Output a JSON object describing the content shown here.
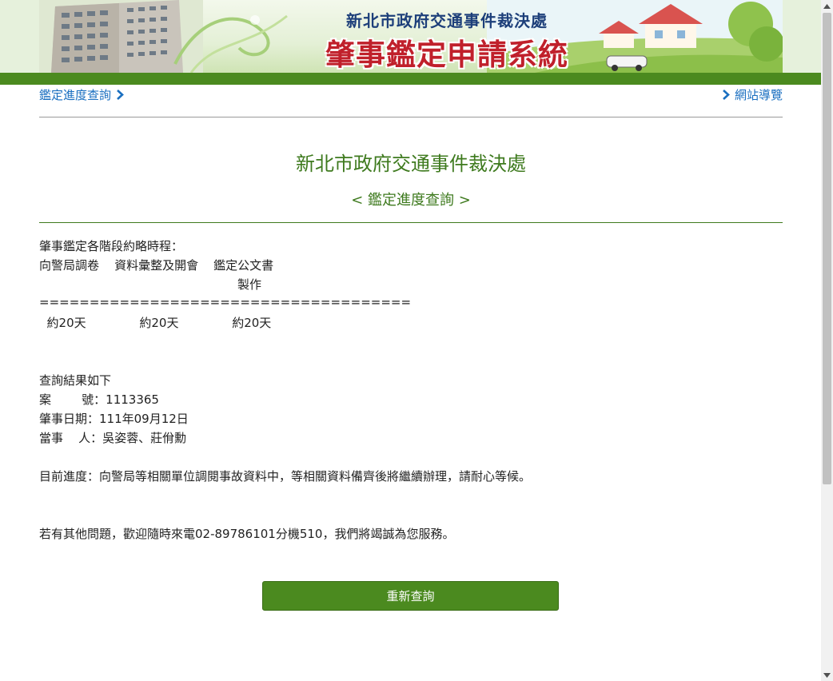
{
  "banner": {
    "subtitle": "新北市政府交通事件裁決處",
    "title": "肇事鑑定申請系統"
  },
  "nav": {
    "left_link": "鑑定進度查詢",
    "right_link": "網站導覽"
  },
  "heading": {
    "org": "新北市政府交通事件裁決處",
    "section": "< 鑑定進度查詢 >"
  },
  "timeline": {
    "title": "肇事鑑定各階段約略時程：",
    "stages_line1": "向警局調卷    資料彙整及開會    鑑定公文書",
    "stages_line2": "製作",
    "separator": "=====================================",
    "durations": "  約20天              約20天              約20天"
  },
  "result": {
    "header": "查詢結果如下",
    "case_no": "案        號：1113365",
    "accident_date": "肇事日期：111年09月12日",
    "parties": "當事    人：吳姿蓉、莊佾勳",
    "progress": "目前進度：向警局等相關單位調閱事故資料中，等相關資料備齊後將繼續辦理，請耐心等候。",
    "contact": "若有其他問題，歡迎隨時來電02-89786101分機510，我們將竭誠為您服務。"
  },
  "buttons": {
    "requery": "重新查詢"
  },
  "colors": {
    "brand_green": "#4b8a1f",
    "heading_green": "#3e7a1e",
    "link_blue": "#1a6fc0",
    "title_red": "#c0202b"
  }
}
